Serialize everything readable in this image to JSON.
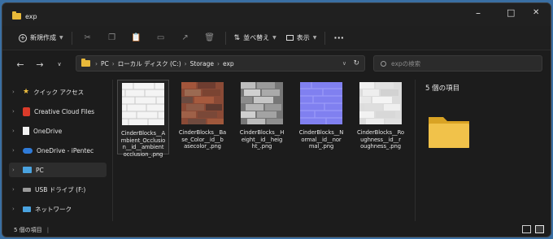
{
  "window": {
    "tab_title": "exp",
    "minimize": "–",
    "maximize": "□",
    "close": "✕"
  },
  "toolbar": {
    "new_label": "新規作成",
    "sort_label": "並べ替え",
    "view_label": "表示",
    "more_label": "···"
  },
  "address": {
    "segments": [
      "PC",
      "ローカル ディスク (C:)",
      "Storage",
      "exp"
    ],
    "search_placeholder": "expの検索"
  },
  "sidebar": {
    "items": [
      {
        "label": "クイック アクセス",
        "icon": "star-icon"
      },
      {
        "label": "Creative Cloud Files",
        "icon": "creative-cloud-icon"
      },
      {
        "label": "OneDrive",
        "icon": "document-icon"
      },
      {
        "label": "OneDrive - iPentec",
        "icon": "onedrive-icon"
      },
      {
        "label": "PC",
        "icon": "pc-icon"
      },
      {
        "label": "USB ドライブ (F:)",
        "icon": "usb-drive-icon"
      },
      {
        "label": "ネットワーク",
        "icon": "network-icon"
      }
    ]
  },
  "files": [
    {
      "name": "CinderBlocks__A\nmbient_Occlusio\nn__id__ambient\nocclusion_.png"
    },
    {
      "name": "CinderBlocks__Ba\nse_Color__id__b\nasecolor_.png"
    },
    {
      "name": "CinderBlocks__H\neight__id__heig\nht_.png"
    },
    {
      "name": "CinderBlocks__N\normal__id__nor\nmal_.png"
    },
    {
      "name": "CinderBlocks__Ro\nughness__id__r\noughness_.png"
    }
  ],
  "preview": {
    "count_text": "5 個の項目"
  },
  "status": {
    "count_text": "5 個の項目"
  },
  "colors": {
    "background": "#1c1c1c",
    "selection": "#2d2d2d",
    "folder": "#e8b93a",
    "accent": "#4c8fd6"
  }
}
